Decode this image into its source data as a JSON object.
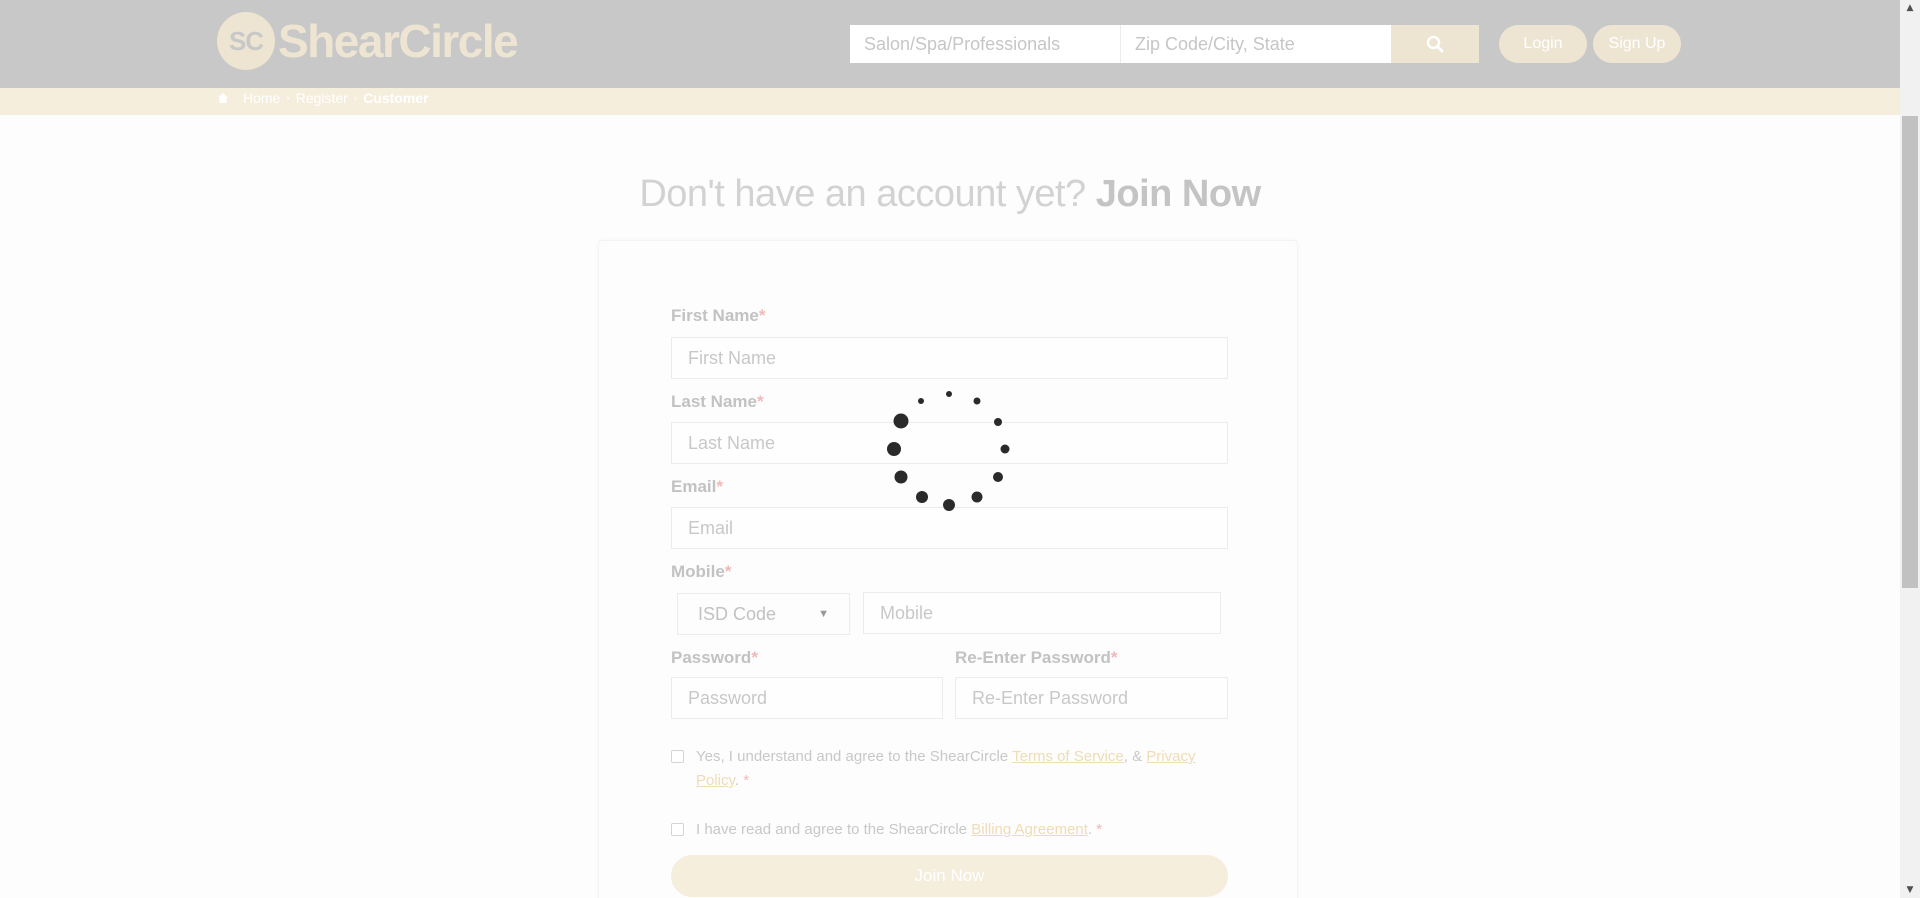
{
  "header": {
    "logo_mark": "SC",
    "logo_text": "ShearCircle",
    "search_primary_placeholder": "Salon/Spa/Professionals",
    "search_location_placeholder": "Zip Code/City, State",
    "search_icon": "search-icon",
    "login_label": "Login",
    "signup_label": "Sign Up"
  },
  "breadcrumb": {
    "home_icon": "home-icon",
    "items": [
      "Home",
      "Register",
      "Customer"
    ]
  },
  "form": {
    "heading_light": "Don't have an account yet?",
    "heading_bold": "Join Now",
    "required_marker": "*",
    "first_name_label": "First Name",
    "first_name_placeholder": "First Name",
    "last_name_label": "Last Name",
    "last_name_placeholder": "Last Name",
    "email_label": "Email",
    "email_placeholder": "Email",
    "mobile_label": "Mobile",
    "isd_selected": "ISD Code",
    "mobile_placeholder": "Mobile",
    "password_label": "Password",
    "password_placeholder": "Password",
    "reenter_label": "Re-Enter Password",
    "reenter_placeholder": "Re-Enter Password",
    "terms_text_1": "Yes, I understand and agree to the ShearCircle",
    "terms_link": "Terms of Service",
    "terms_text_2": ", &",
    "privacy_link": "Privacy Policy",
    "billing_text": "I have read and agree to the ShearCircle",
    "billing_link": "Billing Agreement",
    "submit_label": "Join Now"
  },
  "overlay": {
    "state": "loading",
    "spinner_icon": "loading-spinner-icon"
  },
  "colors": {
    "accent": "#ede5d2",
    "breadcrumb_bar": "#f5eedc",
    "header_dimmed": "#c8c8c8",
    "spinner": "#2a2a2a"
  }
}
